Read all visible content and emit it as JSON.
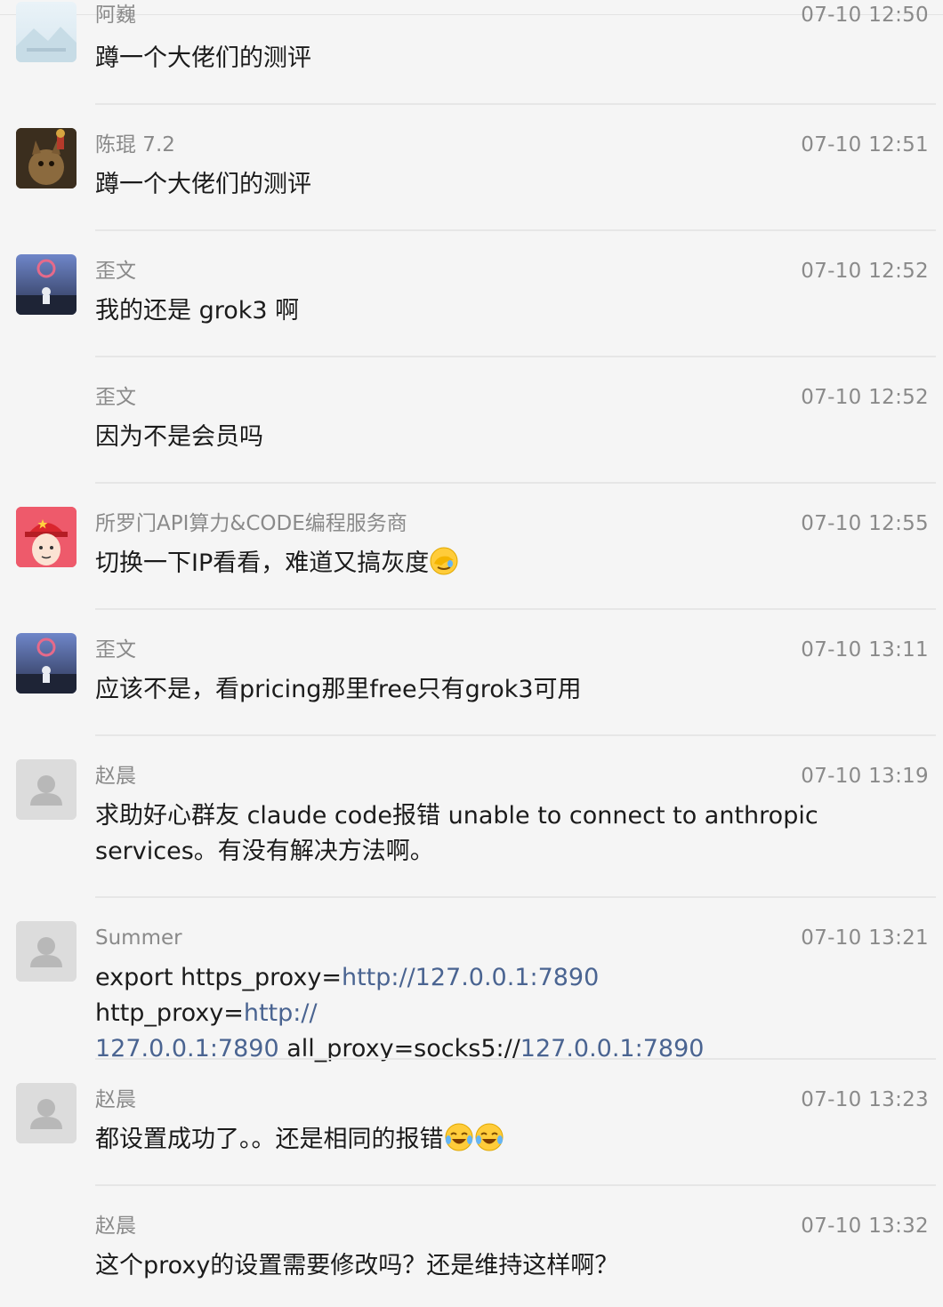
{
  "messages": [
    {
      "name": "阿巍",
      "time": "07-10 12:50",
      "text": "蹲一个大佬们的测评"
    },
    {
      "name": "陈琨 7.2",
      "time": "07-10 12:51",
      "text": "蹲一个大佬们的测评"
    },
    {
      "name": "歪文",
      "time": "07-10 12:52",
      "text": "我的还是 grok3 啊"
    },
    {
      "name": "歪文",
      "time": "07-10 12:52",
      "text": "因为不是会员吗"
    },
    {
      "name": "所罗门API算力&CODE编程服务商",
      "time": "07-10 12:55",
      "text": "切换一下IP看看，难道又搞灰度"
    },
    {
      "name": "歪文",
      "time": "07-10 13:11",
      "text": "应该不是，看pricing那里free只有grok3可用"
    },
    {
      "name": "赵晨",
      "time": "07-10 13:19",
      "text_line1": "求助好心群友 claude code报错 unable to connect to anthropic",
      "text_line2": "services。有没有解决方法啊。"
    },
    {
      "name": "Summer",
      "time": "07-10 13:21",
      "line1_a": "export https_proxy=",
      "line1_link1": "http://127.0.0.1:7890",
      "line1_b": " http_proxy=",
      "line1_link2": "http://",
      "line2_link": "127.0.0.1:7890",
      "line2_a": " all_proxy=socks5://",
      "line2_link2": "127.0.0.1:7890"
    },
    {
      "name": "赵晨",
      "time": "07-10 13:23",
      "text": "都设置成功了。。还是相同的报错"
    },
    {
      "name": "赵晨",
      "time": "07-10 13:32",
      "text": "这个proxy的设置需要修改吗？还是维持这样啊？"
    }
  ],
  "emoji": {
    "facepalm": "facepalm-emoji",
    "laugh": "tears-of-joy-emoji"
  }
}
